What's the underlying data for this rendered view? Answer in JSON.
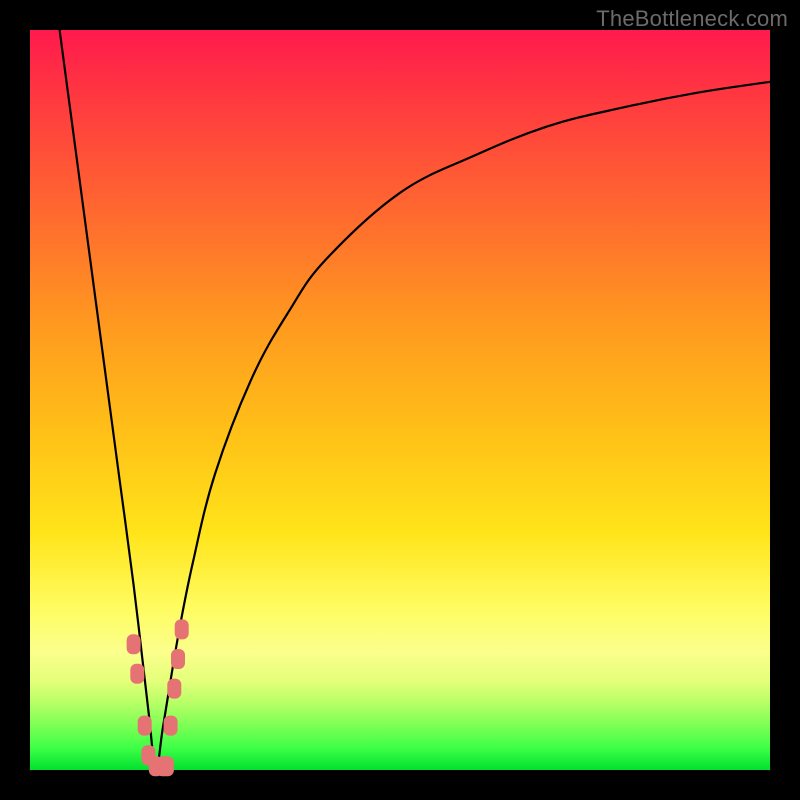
{
  "watermark": {
    "text": "TheBottleneck.com"
  },
  "colors": {
    "frame": "#000000",
    "curve_stroke": "#000000",
    "marker_fill": "#e57373",
    "marker_stroke": "#c85a5a"
  },
  "chart_data": {
    "type": "line",
    "title": "",
    "xlabel": "",
    "ylabel": "",
    "xlim": [
      0,
      100
    ],
    "ylim": [
      0,
      100
    ],
    "grid": false,
    "legend": false,
    "description": "V-shaped bottleneck curve: value descends steeply from top-left to a minimum near x≈17, then rises with diminishing slope toward top-right.",
    "optimum_x": 17,
    "series": [
      {
        "name": "left-branch",
        "x": [
          4,
          6,
          8,
          10,
          12,
          14,
          16,
          17
        ],
        "values": [
          100,
          85,
          70,
          55,
          40,
          25,
          8,
          0
        ]
      },
      {
        "name": "right-branch",
        "x": [
          17,
          18,
          20,
          22,
          25,
          30,
          35,
          40,
          50,
          60,
          70,
          80,
          90,
          100
        ],
        "values": [
          0,
          6,
          18,
          28,
          40,
          53,
          62,
          69,
          78,
          83,
          87,
          89.5,
          91.5,
          93
        ]
      }
    ],
    "markers": {
      "name": "near-optimum-cluster",
      "shape": "rounded-square",
      "points": [
        {
          "x": 14.0,
          "y": 17
        },
        {
          "x": 14.5,
          "y": 13
        },
        {
          "x": 15.5,
          "y": 6
        },
        {
          "x": 16.0,
          "y": 2
        },
        {
          "x": 17.0,
          "y": 0.5
        },
        {
          "x": 18.0,
          "y": 0.5
        },
        {
          "x": 18.5,
          "y": 0.5
        },
        {
          "x": 19.0,
          "y": 6
        },
        {
          "x": 19.5,
          "y": 11
        },
        {
          "x": 20.0,
          "y": 15
        },
        {
          "x": 20.5,
          "y": 19
        }
      ]
    }
  }
}
